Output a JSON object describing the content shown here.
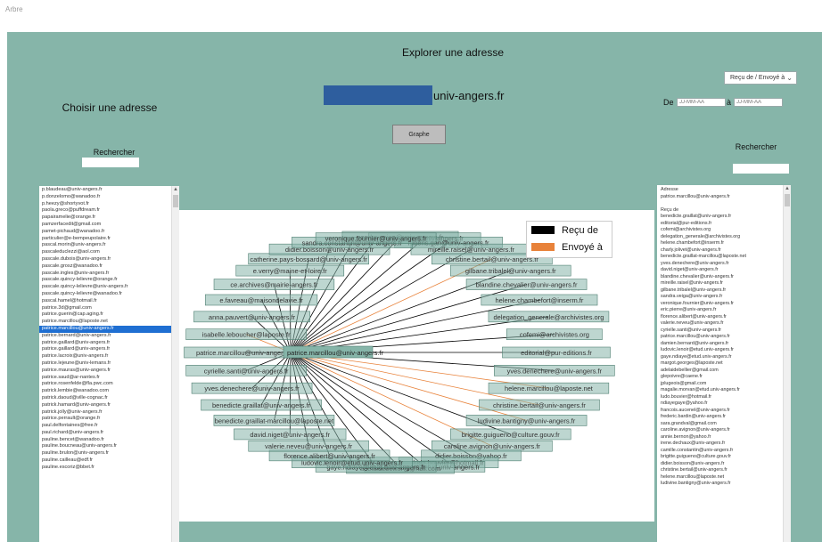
{
  "app": {
    "name": "Arbre",
    "title": "Explorer une adresse"
  },
  "left_panel": {
    "title": "Choisir une adresse",
    "search_label": "Rechercher",
    "search_value": "",
    "items": [
      "p.blaudeau@univ-angers.fr",
      "p.donzelomo@wanadoo.fr",
      "p.heezy@shortyvot.fr",
      "paola.greco@puffdream.fr",
      "papairamelie@orange.fr",
      "pamzerfacedit@gmail.com",
      "pamet-pichaud@wanadoo.fr",
      "particulier@e-bempeupolaire.fr",
      "pascal.morin@univ-angers.fr",
      "pascaleduclezzi@aol.com",
      "pascale.dubois@univ-angers.fr",
      "pascale.grosz@wanadoo.fr",
      "pascale.ingles@univ-angers.fr",
      "pascale.quincy-lelievre@orange.fr",
      "pascale.quincy-lelievre@univ-angers.fr",
      "pascale.quincy-lelievre@wanadoo.fr",
      "pascal.hamel@hotmail.fr",
      "patrice.3d@gmail.com",
      "patrice.guerin@cap.aging.fr",
      "patrice.marcillou@laposte.net",
      "patrice.marcillou@univ-angers.fr",
      "patrice.bernard@univ-angers.fr",
      "patrice.gaillard@univ-angers.fr",
      "patrice.gaillard@univ-angers.fr",
      "patrice.lacroix@univ-angers.fr",
      "patrice.lejeune@univ-lemans.fr",
      "patrice.mauras@univ-angers.fr",
      "patrice.saud@ar-nantes.fr",
      "patrice.rosenfelde@fla.pwc.com",
      "patrick.lembie@wanadoo.com",
      "patrick.daoud@ville-cognac.fr",
      "patrick.hamard@univ-angers.fr",
      "patrick.jolly@univ-angers.fr",
      "patrice.perrault@orange.fr",
      "paul.delfontaines@free.fr",
      "paul.richard@univ-angers.fr",
      "pauline.bencet@wanadoo.fr",
      "pauline.boucneau@univ-angers.fr",
      "pauline.brulon@univ-angers.fr",
      "pauline.cailleau@edf.fr",
      "pauline.escoriz@bbet.fr"
    ],
    "selected_index": 20
  },
  "header": {
    "domain_suffix": "univ-angers.fr",
    "graph_button": "Graphe"
  },
  "right_panel": {
    "direction_select": "Reçu de / Envoyé à",
    "date_from_label": "De",
    "date_to_label": "à",
    "date_from_placeholder": "JJ-MM-AA",
    "date_to_placeholder": "JJ-MM-AA",
    "search_label": "Rechercher",
    "search_value": "",
    "items": [
      "Adresse",
      "patrice.marcillou@univ-angers.fr",
      "",
      "Reçu de",
      "benedicte.graillat@univ-angers.fr",
      "editorial@pur-editions.fr",
      "cofemi@archivistes.org",
      "delegation_generale@archivistes.org",
      "helene.chambefort@inserm.fr",
      "charly.jolivet@univ-angers.fr",
      "benedicte.graillat-marcillou@laposte.net",
      "yves.denechere@univ-angers.fr",
      "david.niget@univ-angers.fr",
      "blandine.chevalier@univ-angers.fr",
      "mireille.raisel@univ-angers.fr",
      "gilbane.tribalel@univ-angers.fr",
      "sandra.veiga@univ-angers.fr",
      "veronique.fournier@univ-angers.fr",
      "eric.pierre@univ-angers.fr",
      "florence.alibert@univ-angers.fr",
      "valerie.neveu@univ-angers.fr",
      "cyrielle.santi@univ-angers.fr",
      "patrice.marcillou@univ-angers.fr",
      "damien.bernard@univ-angers.fr",
      "ludovic.lenoir@etud.univ-angers.fr",
      "gaye.ndiaye@etud.univ-angers.fr",
      "margot.georges@laposte.net",
      "adelaidebellier@gmail.com",
      "glepoivre@caene.fr",
      "jplugeois@gmail.com",
      "magalie.morvan@etud.univ-angers.fr",
      "ludo.bouvier@hotmail.fr",
      "ndiayegaye@yahoo.fr",
      "francois.aucenel@univ-angers.fr",
      "frederic.bardin@univ-angers.fr",
      "sara.grandval@gmail.com",
      "caroline.avignon@univ-angers.fr",
      "annie.bernon@yahoo.fr",
      "irene.dechaux@univ-angers.fr",
      "camille.constantin@univ-angers.fr",
      "brigitte.guigueno@culture.gouv.fr",
      "didier.boisson@univ-angers.fr",
      "christine.bertail@univ-angers.fr",
      "helene.marcillou@laposte.net",
      "ludivine.bantigny@univ-angers.fr"
    ]
  },
  "graph": {
    "center": "patrice.marcillou@univ-angers.fr",
    "legend": [
      {
        "label": "Reçu de",
        "color": "#000000"
      },
      {
        "label": "Envoyé à",
        "color": "#e8823a"
      }
    ],
    "nodes": [
      "sandra.veiga@univ-angers.fr",
      "eric.pierre@univ-angers.fr",
      "rubens.gan@univ-angers.fr",
      "mireille.raisel@univ-angers.fr",
      "christine.bertail@univ-angers.fr",
      "gilbane.tribalel@univ-angers.fr",
      "blandine.chevalier@univ-angers.fr",
      "helene.chambefort@inserm.fr",
      "delegation_generale@archivistes.org",
      "cofemi@archivistes.org",
      "editorial@pur-editions.fr",
      "yves.denechere@univ-angers.fr",
      "helene.marcillou@laposte.net",
      "christine.bertail@univ-angers.fr",
      "ludivine.bantigny@univ-angers.fr",
      "brigitte.guigueno@culture.gouv.fr",
      "caroline.avignon@univ-angers.fr",
      "didier.boisson@yahoo.fr",
      "ludo.bouvier@hotmail.fr",
      "magalie.morvan@etud.univ-angers.fr",
      "adelaidebellier@gmail.com",
      "gaye.ndiaye@etud.univ-angers.fr",
      "ludovic.lenoir@etud.univ-angers.fr",
      "florence.alibert@univ-angers.fr",
      "valerie.neveu@univ-angers.fr",
      "david.niget@univ-angers.fr",
      "benedicte.graillat-marcillou@laposte.net",
      "benedicte.graillat@univ-angers.fr",
      "yves.denechere@univ-angers.fr",
      "cyrielle.santi@univ-angers.fr",
      "patrice.marcillou@univ-angers.fr",
      "isabelle.leboucher@laposte.fr",
      "anna.pauvert@univ-angers.fr",
      "e.favreau@maisondelavie.fr",
      "ce.archives@mairie-angers.fr",
      "e.verry@maine-et-loire.fr",
      "catherine.pays-bossard@univ-angers.fr",
      "didier.boisson@univ-angers.fr",
      "sandra.constantin@univ-angers.fr",
      "veronique.fournier@univ-angers.fr"
    ],
    "sent_to": [
      "helene.marcillou@laposte.net",
      "christine.bertail@univ-angers.fr",
      "ludivine.bantigny@univ-angers.fr",
      "caroline.avignon@univ-angers.fr",
      "isabelle.leboucher@laposte.fr"
    ]
  }
}
